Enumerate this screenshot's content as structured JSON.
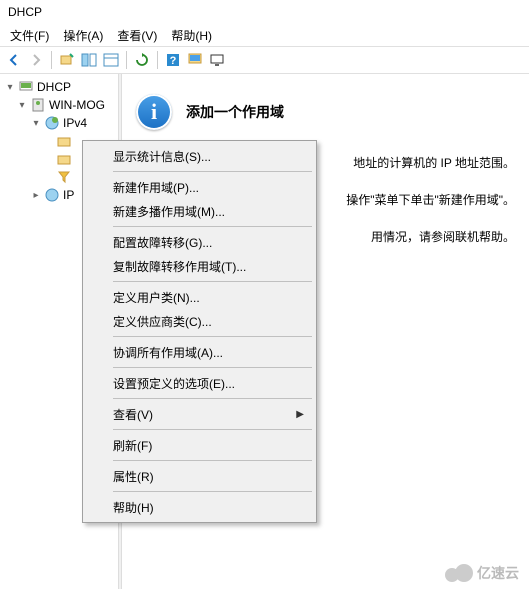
{
  "window": {
    "title": "DHCP"
  },
  "menubar": {
    "file": "文件(F)",
    "action": "操作(A)",
    "view": "查看(V)",
    "help": "帮助(H)"
  },
  "tree": {
    "root": "DHCP",
    "server": "WIN-MOG",
    "ipv4": "IPv4",
    "ipv6": "IPv6",
    "ip": "IP"
  },
  "content": {
    "heading": "添加一个作用域",
    "line1_tail": "地址的计算机的 IP 地址范围。",
    "line2_tail": "操作\"菜单下单击\"新建作用域\"。",
    "line3_tail": "用情况，请参阅联机帮助。"
  },
  "context_menu": {
    "show_stats": "显示统计信息(S)...",
    "new_scope": "新建作用域(P)...",
    "new_multicast": "新建多播作用域(M)...",
    "config_failover": "配置故障转移(G)...",
    "replicate_failover": "复制故障转移作用域(T)...",
    "define_user": "定义用户类(N)...",
    "define_vendor": "定义供应商类(C)...",
    "reconcile": "协调所有作用域(A)...",
    "set_predefined": "设置预定义的选项(E)...",
    "view": "查看(V)",
    "refresh": "刷新(F)",
    "properties": "属性(R)",
    "help": "帮助(H)"
  },
  "watermark": {
    "text": "亿速云"
  }
}
